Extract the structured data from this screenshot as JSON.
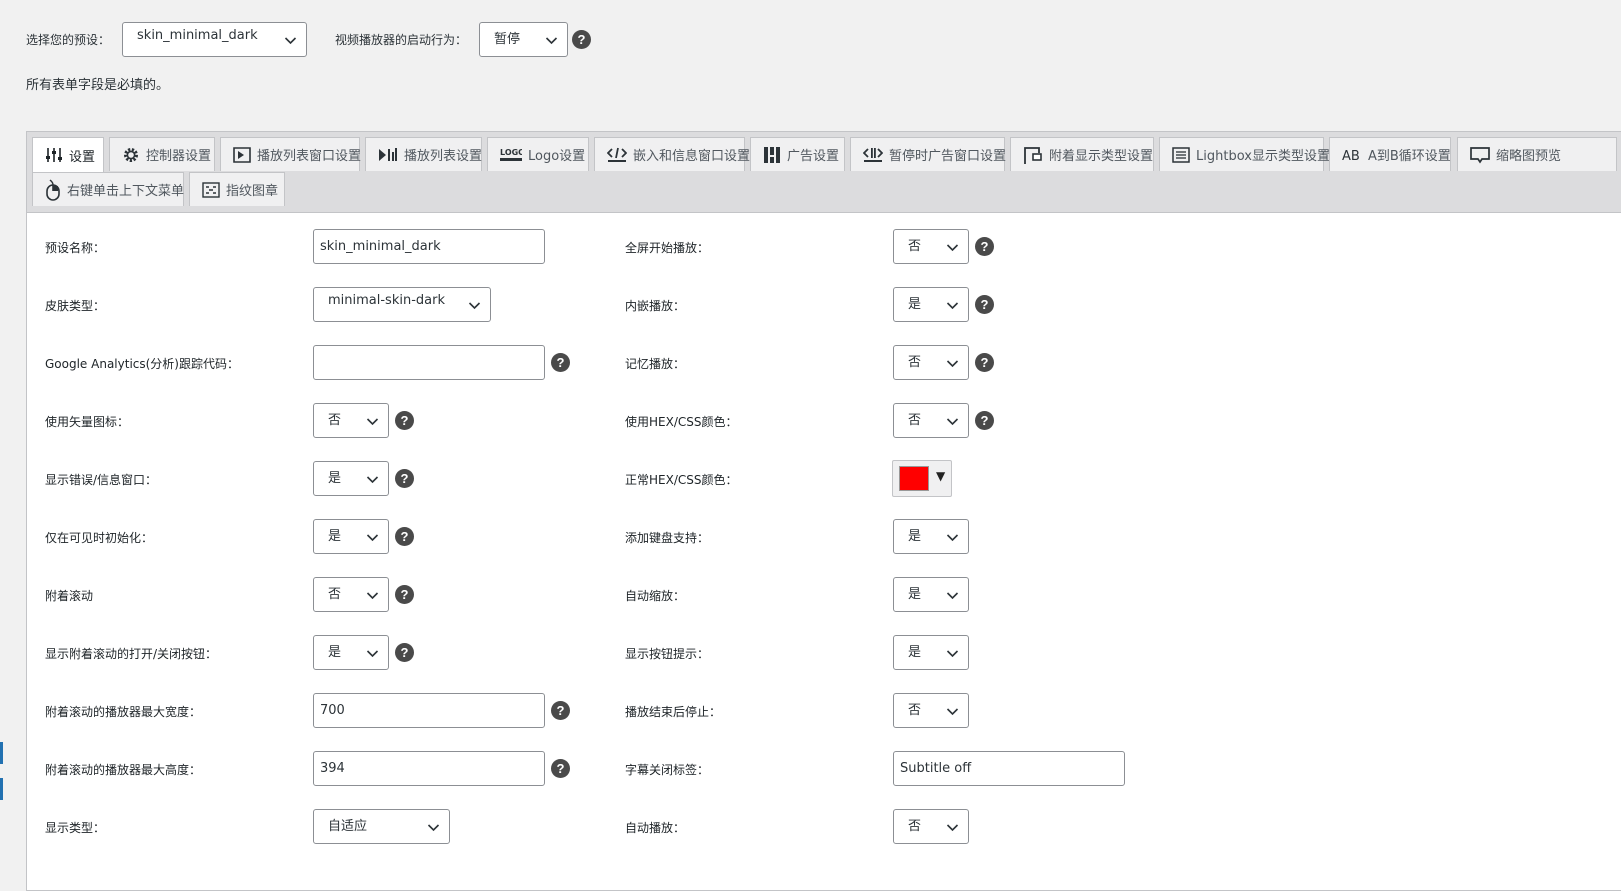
{
  "top": {
    "preset_label": "选择您的预设：",
    "preset_value": "skin_minimal_dark",
    "startup_label": "视频播放器的启动行为：",
    "startup_value": "暂停",
    "required_note": "所有表单字段是必填的。"
  },
  "tabs": [
    {
      "label": "设置",
      "icon": "sliders-icon"
    },
    {
      "label": "控制器设置",
      "icon": "gear-icon"
    },
    {
      "label": "播放列表窗口设置",
      "icon": "playlist-window-icon"
    },
    {
      "label": "播放列表设置",
      "icon": "playlist-icon"
    },
    {
      "label": "Logo设置",
      "icon": "logo-icon"
    },
    {
      "label": "嵌入和信息窗口设置",
      "icon": "embed-icon"
    },
    {
      "label": "广告设置",
      "icon": "ads-icon"
    },
    {
      "label": "暂停时广告窗口设置",
      "icon": "pause-ads-icon"
    },
    {
      "label": "附着显示类型设置",
      "icon": "sticky-icon"
    },
    {
      "label": "Lightbox显示类型设置",
      "icon": "lightbox-icon"
    },
    {
      "label": "A到B循环设置",
      "icon": "ab-loop-icon"
    },
    {
      "label": "缩略图预览",
      "icon": "thumbnail-icon"
    },
    {
      "label": "右键单击上下文菜单",
      "icon": "mouse-icon"
    },
    {
      "label": "指纹图章",
      "icon": "fingerprint-icon"
    }
  ],
  "left": [
    {
      "label": "预设名称：",
      "type": "input",
      "value": "skin_minimal_dark"
    },
    {
      "label": "皮肤类型：",
      "type": "select",
      "value": "minimal-skin-dark"
    },
    {
      "label": "Google Analytics(分析)跟踪代码：",
      "type": "input",
      "value": "",
      "help": true
    },
    {
      "label": "使用矢量图标：",
      "type": "select",
      "value": "否",
      "help": true
    },
    {
      "label": "显示错误/信息窗口：",
      "type": "select",
      "value": "是",
      "help": true
    },
    {
      "label": "仅在可见时初始化：",
      "type": "select",
      "value": "是",
      "help": true
    },
    {
      "label": "附着滚动",
      "type": "select",
      "value": "否",
      "help": true
    },
    {
      "label": "显示附着滚动的打开/关闭按钮：",
      "type": "select",
      "value": "是",
      "help": true
    },
    {
      "label": "附着滚动的播放器最大宽度：",
      "type": "input",
      "value": "700",
      "help": true
    },
    {
      "label": "附着滚动的播放器最大高度：",
      "type": "input",
      "value": "394",
      "help": true
    },
    {
      "label": "显示类型：",
      "type": "select",
      "value": "自适应"
    }
  ],
  "right": [
    {
      "label": "全屏开始播放：",
      "type": "select",
      "value": "否",
      "help": true
    },
    {
      "label": "内嵌播放：",
      "type": "select",
      "value": "是",
      "help": true
    },
    {
      "label": "记忆播放：",
      "type": "select",
      "value": "否",
      "help": true
    },
    {
      "label": "使用HEX/CSS颜色：",
      "type": "select",
      "value": "否",
      "help": true
    },
    {
      "label": "正常HEX/CSS颜色：",
      "type": "color",
      "value": "#ff0000"
    },
    {
      "label": "添加键盘支持：",
      "type": "select",
      "value": "是"
    },
    {
      "label": "自动缩放：",
      "type": "select",
      "value": "是"
    },
    {
      "label": "显示按钮提示：",
      "type": "select",
      "value": "是"
    },
    {
      "label": "播放结束后停止：",
      "type": "select",
      "value": "否"
    },
    {
      "label": "字幕关闭标签：",
      "type": "input",
      "value": "Subtitle off"
    },
    {
      "label": "自动播放：",
      "type": "select",
      "value": "否"
    }
  ],
  "help_glyph": "?",
  "color_arrow": "▼"
}
